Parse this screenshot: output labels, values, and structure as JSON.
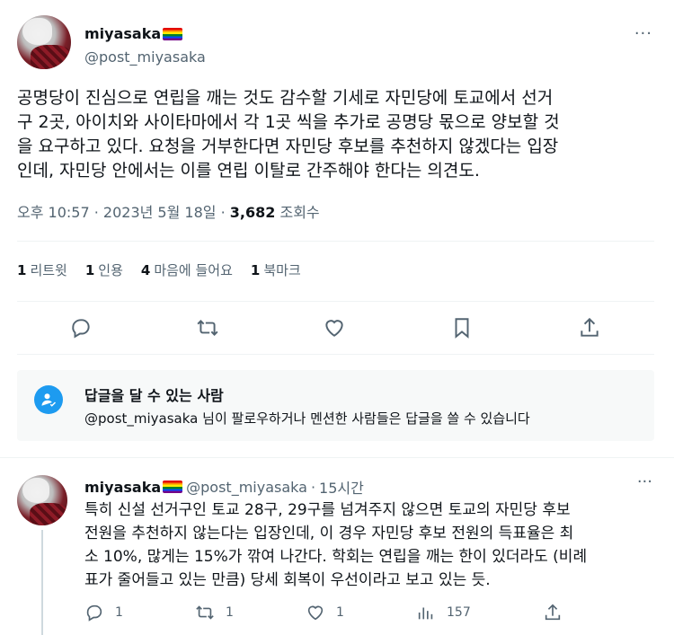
{
  "tweet": {
    "display_name": "miyasaka",
    "handle": "@post_miyasaka",
    "body_lines": [
      "공명당이 진심으로 연립을 깨는 것도 감수할 기세로 자민당에 토교에서 선거",
      "구 2곳, 아이치와 사이타마에서 각 1곳 씩을 추가로 공명당 몫으로 양보할 것",
      "을 요구하고 있다. 요청을 거부한다면 자민당 후보를 추천하지 않겠다는 입장",
      "인데, 자민당 안에서는 이를 연립 이탈로 간주해야 한다는 의견도."
    ],
    "time": "오후 10:57",
    "date": "2023년 5월 18일",
    "views_count": "3,682",
    "views_label": "조회수",
    "stats": [
      {
        "count": "1",
        "label": "리트윗"
      },
      {
        "count": "1",
        "label": "인용"
      },
      {
        "count": "4",
        "label": "마음에 들어요"
      },
      {
        "count": "1",
        "label": "북마크"
      }
    ],
    "more_label": "···"
  },
  "reply_restriction": {
    "title": "답글을 달 수 있는 사람",
    "handle": "@post_miyasaka",
    "text": "님이 팔로우하거나 멘션한 사람들은 답글을 쓸 수 있습니다"
  },
  "reply": {
    "display_name": "miyasaka",
    "handle": "@post_miyasaka",
    "separator": "·",
    "time_ago": "15시간",
    "body_lines": [
      "특히 신설 선거구인 토교 28구, 29구를 넘겨주지 않으면 토교의 자민당 후보",
      "전원을 추천하지 않는다는 입장인데, 이 경우 자민당 후보 전원의 득표율은 최",
      "소 10%, 많게는 15%가 깎여 나간다. 학회는 연립을 깨는 한이 있더라도 (비례",
      "표가 줄어들고 있는 만큼) 당세 회복이 우선이라고 보고 있는 듯."
    ],
    "replies": "1",
    "retweets": "1",
    "likes": "1",
    "views": "157"
  },
  "colors": {
    "accent": "#1d9bf0",
    "secondary_text": "#536471",
    "primary_text": "#0f1419",
    "divider": "#eff3f4"
  },
  "icons": [
    "reply-icon",
    "retweet-icon",
    "like-icon",
    "bookmark-icon",
    "share-icon",
    "views-icon",
    "mention-icon"
  ]
}
